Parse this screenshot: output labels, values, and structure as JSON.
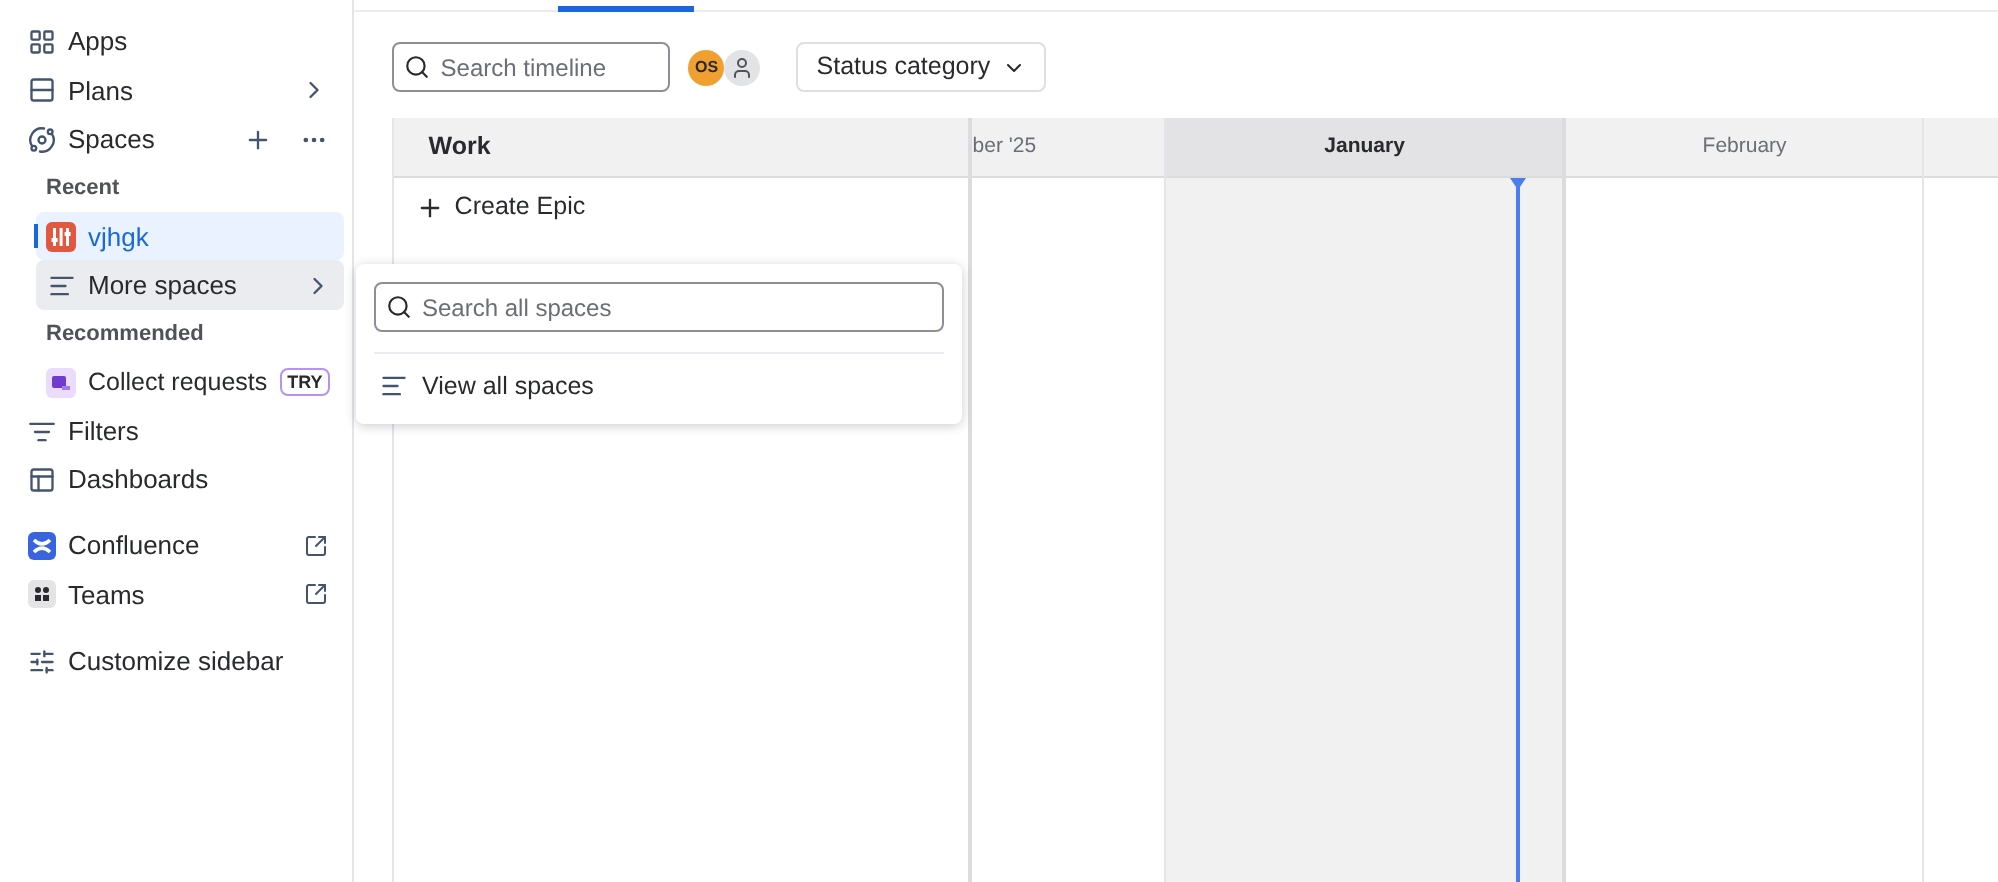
{
  "sidebar": {
    "items": [
      {
        "kind": "nav",
        "label": "Apps",
        "chevron": false,
        "actions": false
      },
      {
        "kind": "nav",
        "label": "Plans",
        "chevron": true,
        "actions": false
      },
      {
        "kind": "nav",
        "label": "Spaces",
        "chevron": false,
        "actions": true
      },
      {
        "kind": "heading",
        "label": "Recent"
      },
      {
        "kind": "space",
        "label": "vjhgk",
        "selected": true
      },
      {
        "kind": "more",
        "label": "More spaces",
        "expanded": true
      },
      {
        "kind": "heading",
        "label": "Recommended"
      },
      {
        "kind": "recommended",
        "label": "Collect requests",
        "badge": "TRY"
      },
      {
        "kind": "nav",
        "label": "Filters",
        "chevron": false,
        "actions": false
      },
      {
        "kind": "nav",
        "label": "Dashboards",
        "chevron": false,
        "actions": false
      },
      {
        "kind": "app",
        "label": "Confluence",
        "color": "#3a63e0"
      },
      {
        "kind": "app",
        "label": "Teams",
        "color": "#e4e4e7"
      },
      {
        "kind": "customize",
        "label": "Customize sidebar"
      }
    ]
  },
  "toolbar": {
    "search": {
      "placeholder": "Search timeline"
    },
    "avatars": [
      {
        "kind": "initials",
        "text": "OS",
        "color": "#f0a030"
      },
      {
        "kind": "generic",
        "color": "#e2e3e5"
      }
    ],
    "filter": {
      "label": "Status category"
    }
  },
  "timeline": {
    "work_header": "Work",
    "create": "Create Epic",
    "months": [
      {
        "label": "ber '25",
        "current": false
      },
      {
        "label": "January",
        "current": true
      },
      {
        "label": "February",
        "current": false
      },
      {
        "current": false
      }
    ]
  },
  "popover": {
    "search": {
      "placeholder": "Search all spaces"
    },
    "items": [
      {
        "label": "View all spaces"
      }
    ]
  }
}
